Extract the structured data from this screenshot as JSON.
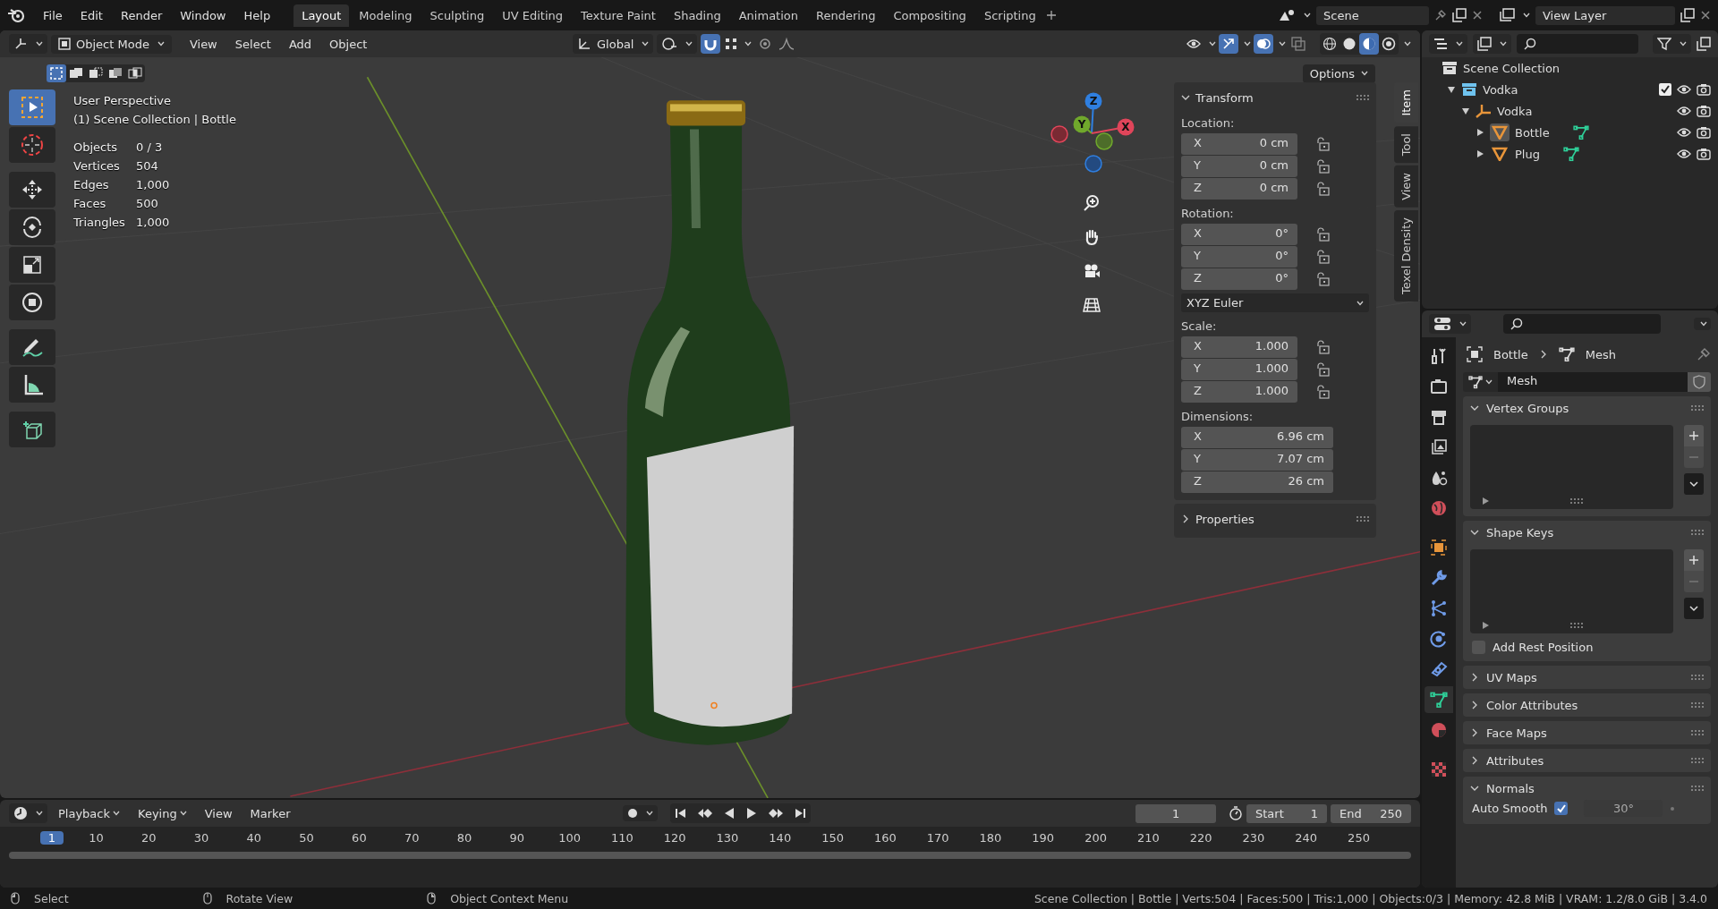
{
  "menu": [
    "File",
    "Edit",
    "Render",
    "Window",
    "Help"
  ],
  "workspaces": [
    {
      "label": "Layout",
      "selected": true
    },
    {
      "label": "Modeling",
      "selected": false
    },
    {
      "label": "Sculpting",
      "selected": false
    },
    {
      "label": "UV Editing",
      "selected": false
    },
    {
      "label": "Texture Paint",
      "selected": false
    },
    {
      "label": "Shading",
      "selected": false
    },
    {
      "label": "Animation",
      "selected": false
    },
    {
      "label": "Rendering",
      "selected": false
    },
    {
      "label": "Compositing",
      "selected": false
    },
    {
      "label": "Scripting",
      "selected": false
    }
  ],
  "scene": "Scene",
  "view_layer": "View Layer",
  "viewport_header": {
    "mode": "Object Mode",
    "menus": [
      "View",
      "Select",
      "Add",
      "Object"
    ],
    "orientation": "Global",
    "toggles": [
      {
        "kind": "snap",
        "on": true
      },
      {
        "kind": "proportional",
        "on": false
      }
    ],
    "display": [
      {
        "kind": "visibility",
        "on": false
      },
      {
        "kind": "gizmo",
        "on": true
      },
      {
        "kind": "overlay",
        "on": true
      },
      {
        "kind": "xray",
        "on": false
      }
    ],
    "shading": [
      {
        "kind": "wireframe",
        "selected": false
      },
      {
        "kind": "solid",
        "selected": false
      },
      {
        "kind": "material",
        "selected": true
      },
      {
        "kind": "rendered",
        "selected": false
      }
    ]
  },
  "select_modes": [
    {
      "kind": "new",
      "selected": true
    },
    {
      "kind": "extend",
      "selected": false
    },
    {
      "kind": "subtract",
      "selected": false
    },
    {
      "kind": "invert",
      "selected": false
    },
    {
      "kind": "intersect",
      "selected": false
    }
  ],
  "options": "Options",
  "overlay": {
    "title": "User Perspective",
    "subtitle": "(1) Scene Collection | Bottle",
    "stats": [
      {
        "label": "Objects",
        "value": "0 / 3"
      },
      {
        "label": "Vertices",
        "value": "504"
      },
      {
        "label": "Edges",
        "value": "1,000"
      },
      {
        "label": "Faces",
        "value": "500"
      },
      {
        "label": "Triangles",
        "value": "1,000"
      }
    ]
  },
  "tools": [
    {
      "kind": "select-box",
      "selected": true
    },
    {
      "kind": "cursor",
      "selected": false
    },
    {
      "kind": "move",
      "selected": false
    },
    {
      "kind": "rotate",
      "selected": false
    },
    {
      "kind": "scale",
      "selected": false
    },
    {
      "kind": "transform",
      "selected": false
    },
    {
      "kind": "annotate",
      "selected": false
    },
    {
      "kind": "measure",
      "selected": false
    },
    {
      "kind": "add-cube",
      "selected": false
    }
  ],
  "gizmo_axes": [
    "Z",
    "Y",
    "X"
  ],
  "sidebar_tabs": [
    {
      "label": "Item",
      "selected": true
    },
    {
      "label": "Tool",
      "selected": false
    },
    {
      "label": "View",
      "selected": false
    },
    {
      "label": "Texel Density",
      "selected": false
    }
  ],
  "transform": {
    "title": "Transform",
    "expanded": true,
    "groups": [
      {
        "label": "Location:",
        "kind": "locked",
        "fields": [
          {
            "axis": "X",
            "value": "0 cm"
          },
          {
            "axis": "Y",
            "value": "0 cm"
          },
          {
            "axis": "Z",
            "value": "0 cm"
          }
        ]
      },
      {
        "label": "Rotation:",
        "kind": "locked",
        "fields": [
          {
            "axis": "X",
            "value": "0°"
          },
          {
            "axis": "Y",
            "value": "0°"
          },
          {
            "axis": "Z",
            "value": "0°"
          }
        ],
        "mode": "XYZ Euler"
      },
      {
        "label": "Scale:",
        "kind": "locked",
        "fields": [
          {
            "axis": "X",
            "value": "1.000"
          },
          {
            "axis": "Y",
            "value": "1.000"
          },
          {
            "axis": "Z",
            "value": "1.000"
          }
        ]
      },
      {
        "label": "Dimensions:",
        "kind": "plain",
        "fields": [
          {
            "axis": "X",
            "value": "6.96 cm"
          },
          {
            "axis": "Y",
            "value": "7.07 cm"
          },
          {
            "axis": "Z",
            "value": "26 cm"
          }
        ]
      }
    ]
  },
  "properties_section": {
    "title": "Properties",
    "expanded": false
  },
  "outliner": {
    "root": "Scene Collection",
    "tree": [
      {
        "name": "Vodka",
        "kind": "collection",
        "expanded": true,
        "checked": true,
        "children": [
          {
            "name": "Vodka",
            "kind": "empty",
            "expanded": true,
            "children": [
              {
                "name": "Bottle",
                "kind": "mesh",
                "expanded": false,
                "selected": true
              },
              {
                "name": "Plug",
                "kind": "mesh",
                "expanded": false,
                "selected": false
              }
            ]
          }
        ]
      }
    ]
  },
  "property_tabs": [
    {
      "kind": "tool",
      "selected": false
    },
    {
      "kind": "render",
      "selected": false
    },
    {
      "kind": "output",
      "selected": false
    },
    {
      "kind": "view-layer",
      "selected": false
    },
    {
      "kind": "scene",
      "selected": false
    },
    {
      "kind": "world",
      "selected": false
    },
    {
      "kind": "object",
      "selected": false
    },
    {
      "kind": "modifiers",
      "selected": false
    },
    {
      "kind": "particles",
      "selected": false
    },
    {
      "kind": "physics",
      "selected": false
    },
    {
      "kind": "constraints",
      "selected": false
    },
    {
      "kind": "data",
      "selected": true
    },
    {
      "kind": "material",
      "selected": false
    },
    {
      "kind": "texture",
      "selected": false
    }
  ],
  "breadcrumb": [
    "Bottle",
    "Mesh"
  ],
  "datablock": "Mesh",
  "panels": [
    {
      "title": "Vertex Groups",
      "kind": "list",
      "expanded": true
    },
    {
      "title": "Shape Keys",
      "kind": "list",
      "expanded": true,
      "option": {
        "label": "Add Rest Position",
        "checked": false
      }
    },
    {
      "title": "UV Maps",
      "expanded": false
    },
    {
      "title": "Color Attributes",
      "expanded": false
    },
    {
      "title": "Face Maps",
      "expanded": false
    },
    {
      "title": "Attributes",
      "expanded": false
    },
    {
      "title": "Normals",
      "kind": "normals",
      "expanded": true,
      "option": {
        "label": "Auto Smooth",
        "checked": true,
        "value": "30°"
      }
    }
  ],
  "timeline": {
    "menus": [
      "Playback",
      "Keying",
      "View",
      "Marker"
    ],
    "current": "1",
    "start_label": "Start",
    "start": "1",
    "end_label": "End",
    "end": "250",
    "ticks": [
      {
        "label": "1",
        "selected": true
      },
      {
        "label": "10",
        "selected": false
      },
      {
        "label": "20",
        "selected": false
      },
      {
        "label": "30",
        "selected": false
      },
      {
        "label": "40",
        "selected": false
      },
      {
        "label": "50",
        "selected": false
      },
      {
        "label": "60",
        "selected": false
      },
      {
        "label": "70",
        "selected": false
      },
      {
        "label": "80",
        "selected": false
      },
      {
        "label": "90",
        "selected": false
      },
      {
        "label": "100",
        "selected": false
      },
      {
        "label": "110",
        "selected": false
      },
      {
        "label": "120",
        "selected": false
      },
      {
        "label": "130",
        "selected": false
      },
      {
        "label": "140",
        "selected": false
      },
      {
        "label": "150",
        "selected": false
      },
      {
        "label": "160",
        "selected": false
      },
      {
        "label": "170",
        "selected": false
      },
      {
        "label": "180",
        "selected": false
      },
      {
        "label": "190",
        "selected": false
      },
      {
        "label": "200",
        "selected": false
      },
      {
        "label": "210",
        "selected": false
      },
      {
        "label": "220",
        "selected": false
      },
      {
        "label": "230",
        "selected": false
      },
      {
        "label": "240",
        "selected": false
      },
      {
        "label": "250",
        "selected": false
      }
    ]
  },
  "status": {
    "hints": [
      "Select",
      "Rotate View",
      "Object Context Menu"
    ],
    "stats": "Scene Collection | Bottle | Verts:504 | Faces:500 | Tris:1,000 | Objects:0/3 | Memory: 42.8 MiB | VRAM: 1.2/8.0 GiB | 3.4.0"
  }
}
